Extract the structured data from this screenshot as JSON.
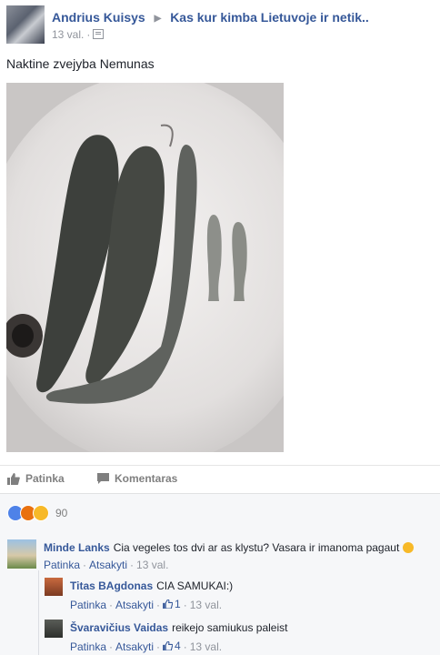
{
  "post": {
    "author": "Andrius Kuisys",
    "group": "Kas kur kimba Lietuvoje ir netik..",
    "time": "13 val.",
    "text": "Naktine zvejyba Nemunas"
  },
  "actions": {
    "like_label": "Patinka",
    "comment_label": "Komentaras"
  },
  "reactions": {
    "count": "90",
    "types": [
      "like",
      "angry",
      "wow"
    ]
  },
  "comments": [
    {
      "author": "Minde Lanks",
      "text": "Cia vegeles tos dvi ar as klystu? Vasara ir imanoma pagaut",
      "like_label": "Patinka",
      "reply_label": "Atsakyti",
      "time": "13 val."
    },
    {
      "author": "Titas BAgdonas",
      "text": "CIA SAMUKAI:)",
      "like_label": "Patinka",
      "reply_label": "Atsakyti",
      "likes": "1",
      "time": "13 val."
    },
    {
      "author": "Švaravičius Vaidas",
      "text": "reikejo samiukus paleist",
      "like_label": "Patinka",
      "reply_label": "Atsakyti",
      "likes": "4",
      "time": "13 val."
    }
  ],
  "colors": {
    "link": "#365899",
    "meta": "#90949c",
    "like_blue": "#4e82e8",
    "angry": "#e9710f",
    "wow": "#f7b928"
  }
}
